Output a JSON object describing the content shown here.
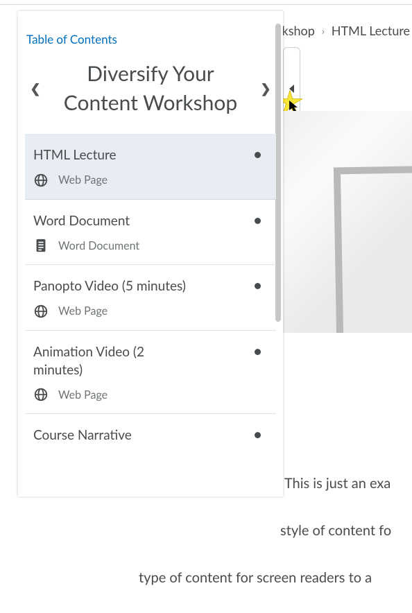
{
  "breadcrumb": {
    "partial": "rkshop",
    "current": "HTML Lecture"
  },
  "panel": {
    "toc_label": "Table of Contents",
    "course_title": "Diversify Your Content Workshop",
    "items": [
      {
        "title": "HTML Lecture",
        "type_label": "Web Page",
        "icon": "globe",
        "active": true
      },
      {
        "title": "Word Document",
        "type_label": "Word Document",
        "icon": "document",
        "active": false
      },
      {
        "title": "Panopto Video (5 minutes)",
        "type_label": "Web Page",
        "icon": "globe",
        "active": false
      },
      {
        "title": "Animation Video (2 minutes)",
        "type_label": "Web Page",
        "icon": "globe",
        "active": false
      },
      {
        "title": "Course Narrative",
        "type_label": "",
        "icon": "",
        "active": false
      }
    ]
  },
  "body": {
    "line1": "! This is just an exa",
    "line2": " style of content fo",
    "line3": "type of content for screen readers to a"
  }
}
